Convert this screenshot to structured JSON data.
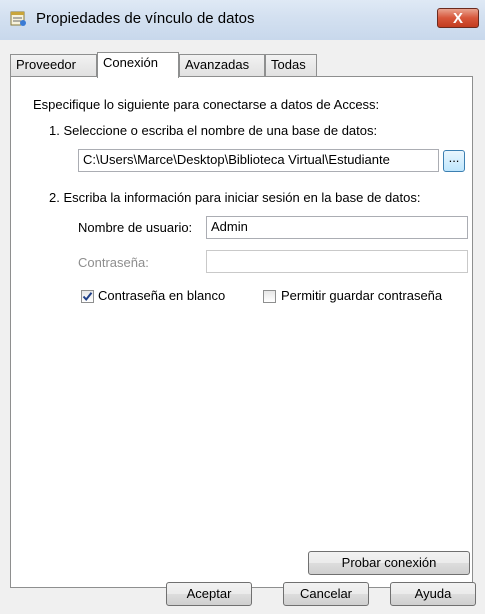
{
  "window": {
    "title": "Propiedades de vínculo de datos",
    "close_glyph": "X"
  },
  "tabs": [
    {
      "label": "Proveedor",
      "active": false
    },
    {
      "label": "Conexión",
      "active": true
    },
    {
      "label": "Avanzadas",
      "active": false
    },
    {
      "label": "Todas",
      "active": false
    }
  ],
  "connection": {
    "intro": "Especifique lo siguiente para conectarse a datos de Access:",
    "step1_label": "1. Seleccione o escriba el nombre de una base de datos:",
    "database_path": "C:\\Users\\Marce\\Desktop\\Biblioteca Virtual\\Estudiante",
    "browse_label": "...",
    "step2_label": "2. Escriba la información para iniciar sesión en la base de datos:",
    "username_label": "Nombre de usuario:",
    "username_value": "Admin",
    "password_label": "Contraseña:",
    "password_value": "",
    "blank_password_label": "Contraseña en blanco",
    "blank_password_checked": true,
    "allow_save_label": "Permitir guardar contraseña",
    "allow_save_checked": false,
    "test_button_label": "Probar conexión"
  },
  "footer": {
    "ok_label": "Aceptar",
    "cancel_label": "Cancelar",
    "help_label": "Ayuda"
  },
  "colors": {
    "titlebar": "#d3e0f0",
    "close_button": "#c23c20",
    "dialog_background": "#f0f0f0",
    "disabled_text": "#8e8e8e"
  }
}
